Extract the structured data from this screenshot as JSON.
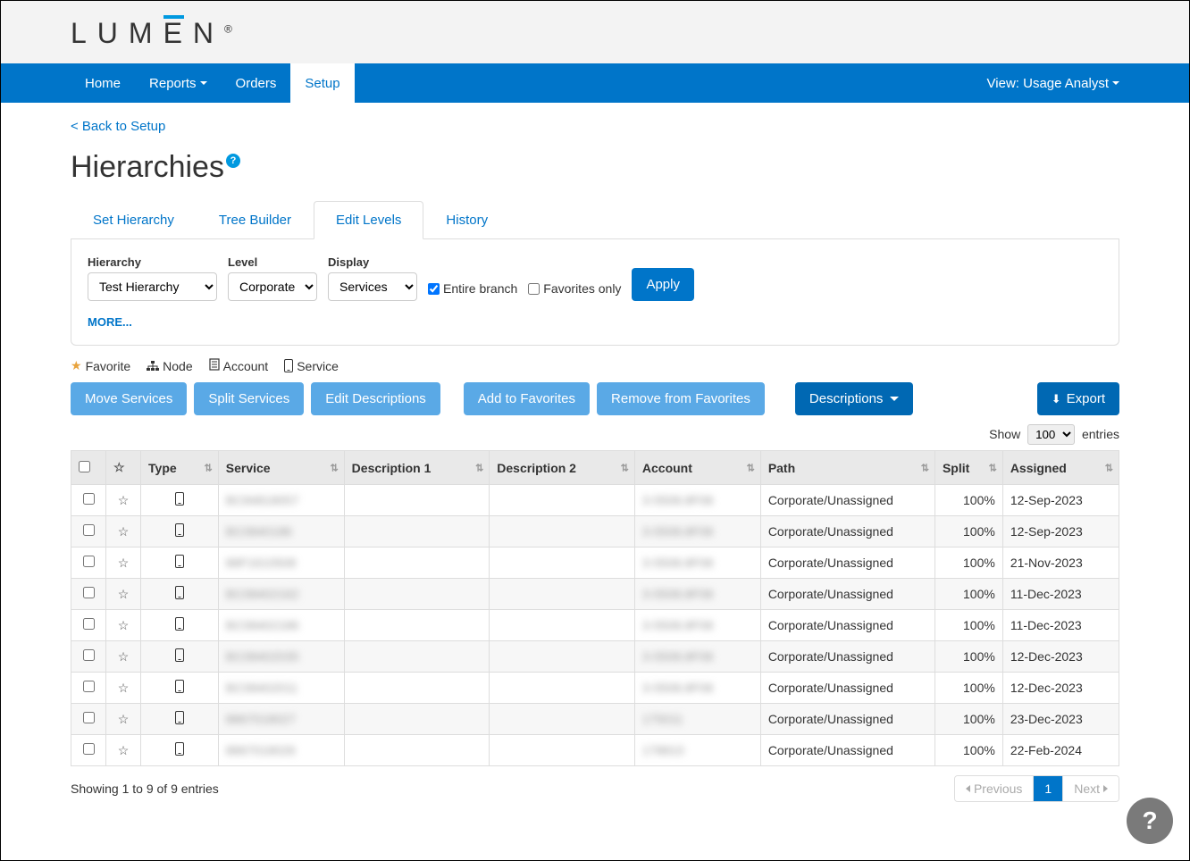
{
  "brand": "LUMEN",
  "nav": {
    "items": [
      "Home",
      "Reports",
      "Orders",
      "Setup"
    ],
    "active_index": 3,
    "dropdown_indices": [
      1
    ],
    "view_label": "View: Usage Analyst"
  },
  "back_link": "< Back to Setup",
  "page_title": "Hierarchies",
  "tabs": {
    "items": [
      "Set Hierarchy",
      "Tree Builder",
      "Edit Levels",
      "History"
    ],
    "active_index": 2
  },
  "filters": {
    "hierarchy_label": "Hierarchy",
    "hierarchy_value": "Test Hierarchy",
    "level_label": "Level",
    "level_value": "Corporate",
    "display_label": "Display",
    "display_value": "Services",
    "entire_branch_label": "Entire branch",
    "entire_branch_checked": true,
    "favorites_only_label": "Favorites only",
    "favorites_only_checked": false,
    "apply_label": "Apply",
    "more_label": "MORE..."
  },
  "legend": {
    "favorite": "Favorite",
    "node": "Node",
    "account": "Account",
    "service": "Service"
  },
  "actions": {
    "move_services": "Move Services",
    "split_services": "Split Services",
    "edit_descriptions": "Edit Descriptions",
    "add_to_favorites": "Add to Favorites",
    "remove_from_favorites": "Remove from Favorites",
    "descriptions": "Descriptions",
    "export": "Export"
  },
  "show": {
    "prefix": "Show",
    "value": "100",
    "suffix": "entries"
  },
  "table": {
    "headers": {
      "type": "Type",
      "service": "Service",
      "desc1": "Description 1",
      "desc2": "Description 2",
      "account": "Account",
      "path": "Path",
      "split": "Split",
      "assigned": "Assigned"
    },
    "rows": [
      {
        "service": "BC84818057",
        "desc1": "",
        "desc2": "",
        "account": "3-5508.8F08",
        "path": "Corporate/Unassigned",
        "split": "100%",
        "assigned": "12-Sep-2023"
      },
      {
        "service": "BC0840186",
        "desc1": "",
        "desc2": "",
        "account": "3-5508.8F08",
        "path": "Corporate/Unassigned",
        "split": "100%",
        "assigned": "12-Sep-2023"
      },
      {
        "service": "88F1610508",
        "desc1": "",
        "desc2": "",
        "account": "3-5508.8F08",
        "path": "Corporate/Unassigned",
        "split": "100%",
        "assigned": "21-Nov-2023"
      },
      {
        "service": "BC08402162",
        "desc1": "",
        "desc2": "",
        "account": "3-5508.8F08",
        "path": "Corporate/Unassigned",
        "split": "100%",
        "assigned": "11-Dec-2023"
      },
      {
        "service": "BC08402186",
        "desc1": "",
        "desc2": "",
        "account": "3-5508.8F08",
        "path": "Corporate/Unassigned",
        "split": "100%",
        "assigned": "11-Dec-2023"
      },
      {
        "service": "BC08402035",
        "desc1": "",
        "desc2": "",
        "account": "3-5508.8F08",
        "path": "Corporate/Unassigned",
        "split": "100%",
        "assigned": "12-Dec-2023"
      },
      {
        "service": "BC08402011",
        "desc1": "",
        "desc2": "",
        "account": "3-5508.8F08",
        "path": "Corporate/Unassigned",
        "split": "100%",
        "assigned": "12-Dec-2023"
      },
      {
        "service": "8867018027",
        "desc1": "",
        "desc2": "",
        "account": "175011",
        "path": "Corporate/Unassigned",
        "split": "100%",
        "assigned": "23-Dec-2023"
      },
      {
        "service": "8867018026",
        "desc1": "",
        "desc2": "",
        "account": "178810",
        "path": "Corporate/Unassigned",
        "split": "100%",
        "assigned": "22-Feb-2024"
      }
    ]
  },
  "footer": {
    "showing": "Showing 1 to 9 of 9 entries",
    "previous": "Previous",
    "next": "Next",
    "page": "1"
  }
}
